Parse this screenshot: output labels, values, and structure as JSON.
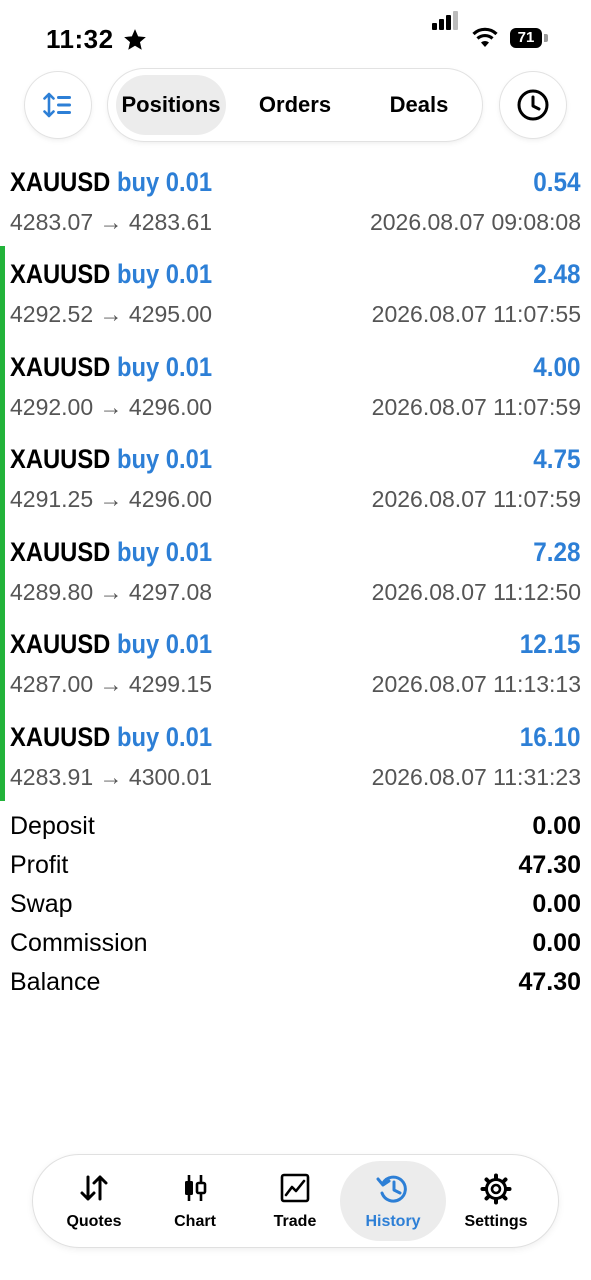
{
  "status_bar": {
    "time": "11:32",
    "battery": "71"
  },
  "header": {
    "tabs": [
      {
        "label": "Positions",
        "active": true
      },
      {
        "label": "Orders",
        "active": false
      },
      {
        "label": "Deals",
        "active": false
      }
    ]
  },
  "deals": [
    {
      "symbol": "XAUUSD",
      "side": "buy 0.01",
      "profit": "0.54",
      "prices": "4283.07 → 4283.61",
      "date": "2026.08.07 09:08:08"
    },
    {
      "symbol": "XAUUSD",
      "side": "buy 0.01",
      "profit": "2.48",
      "prices": "4292.52 → 4295.00",
      "date": "2026.08.07 11:07:55"
    },
    {
      "symbol": "XAUUSD",
      "side": "buy 0.01",
      "profit": "4.00",
      "prices": "4292.00 → 4296.00",
      "date": "2026.08.07 11:07:59"
    },
    {
      "symbol": "XAUUSD",
      "side": "buy 0.01",
      "profit": "4.75",
      "prices": "4291.25 → 4296.00",
      "date": "2026.08.07 11:07:59"
    },
    {
      "symbol": "XAUUSD",
      "side": "buy 0.01",
      "profit": "7.28",
      "prices": "4289.80 → 4297.08",
      "date": "2026.08.07 11:12:50"
    },
    {
      "symbol": "XAUUSD",
      "side": "buy 0.01",
      "profit": "12.15",
      "prices": "4287.00 → 4299.15",
      "date": "2026.08.07 11:13:13"
    },
    {
      "symbol": "XAUUSD",
      "side": "buy 0.01",
      "profit": "16.10",
      "prices": "4283.91 → 4300.01",
      "date": "2026.08.07 11:31:23"
    }
  ],
  "summary": [
    {
      "label": "Deposit",
      "value": "0.00"
    },
    {
      "label": "Profit",
      "value": "47.30"
    },
    {
      "label": "Swap",
      "value": "0.00"
    },
    {
      "label": "Commission",
      "value": "0.00"
    },
    {
      "label": "Balance",
      "value": "47.30"
    }
  ],
  "tabbar": [
    {
      "label": "Quotes",
      "icon": "quotes-arrows-icon"
    },
    {
      "label": "Chart",
      "icon": "candlestick-icon"
    },
    {
      "label": "Trade",
      "icon": "trade-chart-icon"
    },
    {
      "label": "History",
      "icon": "history-icon",
      "active": true
    },
    {
      "label": "Settings",
      "icon": "gear-icon"
    }
  ],
  "colors": {
    "accent": "#2d7fd6",
    "profit_marker": "#22b33a"
  }
}
